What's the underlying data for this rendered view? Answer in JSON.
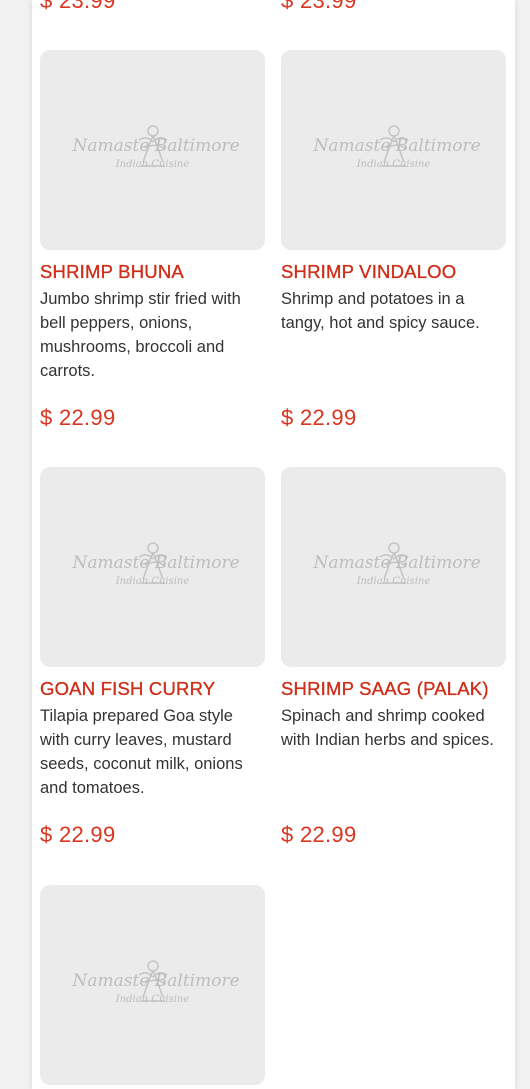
{
  "previous_prices": [
    "$ 23.99",
    "$ 23.99"
  ],
  "logo": {
    "brand": "Namaste Baltimore",
    "tagline": "Indian Cuisine"
  },
  "items": [
    {
      "name": "SHRIMP BHUNA",
      "description": "Jumbo shrimp stir fried with bell peppers, onions, mushrooms, broccoli and carrots.",
      "price": "$ 22.99"
    },
    {
      "name": "SHRIMP VINDALOO",
      "description": "Shrimp and potatoes in a tangy, hot and spicy sauce.",
      "price": "$ 22.99"
    },
    {
      "name": "GOAN FISH CURRY",
      "description": "Tilapia prepared Goa style with curry leaves, mustard seeds, coconut milk, onions and tomatoes.",
      "price": "$ 22.99"
    },
    {
      "name": "SHRIMP SAAG (PALAK)",
      "description": "Spinach and shrimp cooked with Indian herbs and spices.",
      "price": "$ 22.99"
    }
  ],
  "colors": {
    "accent": "#cf2e19",
    "text": "#333333",
    "placeholder_bg": "#ebebeb"
  }
}
